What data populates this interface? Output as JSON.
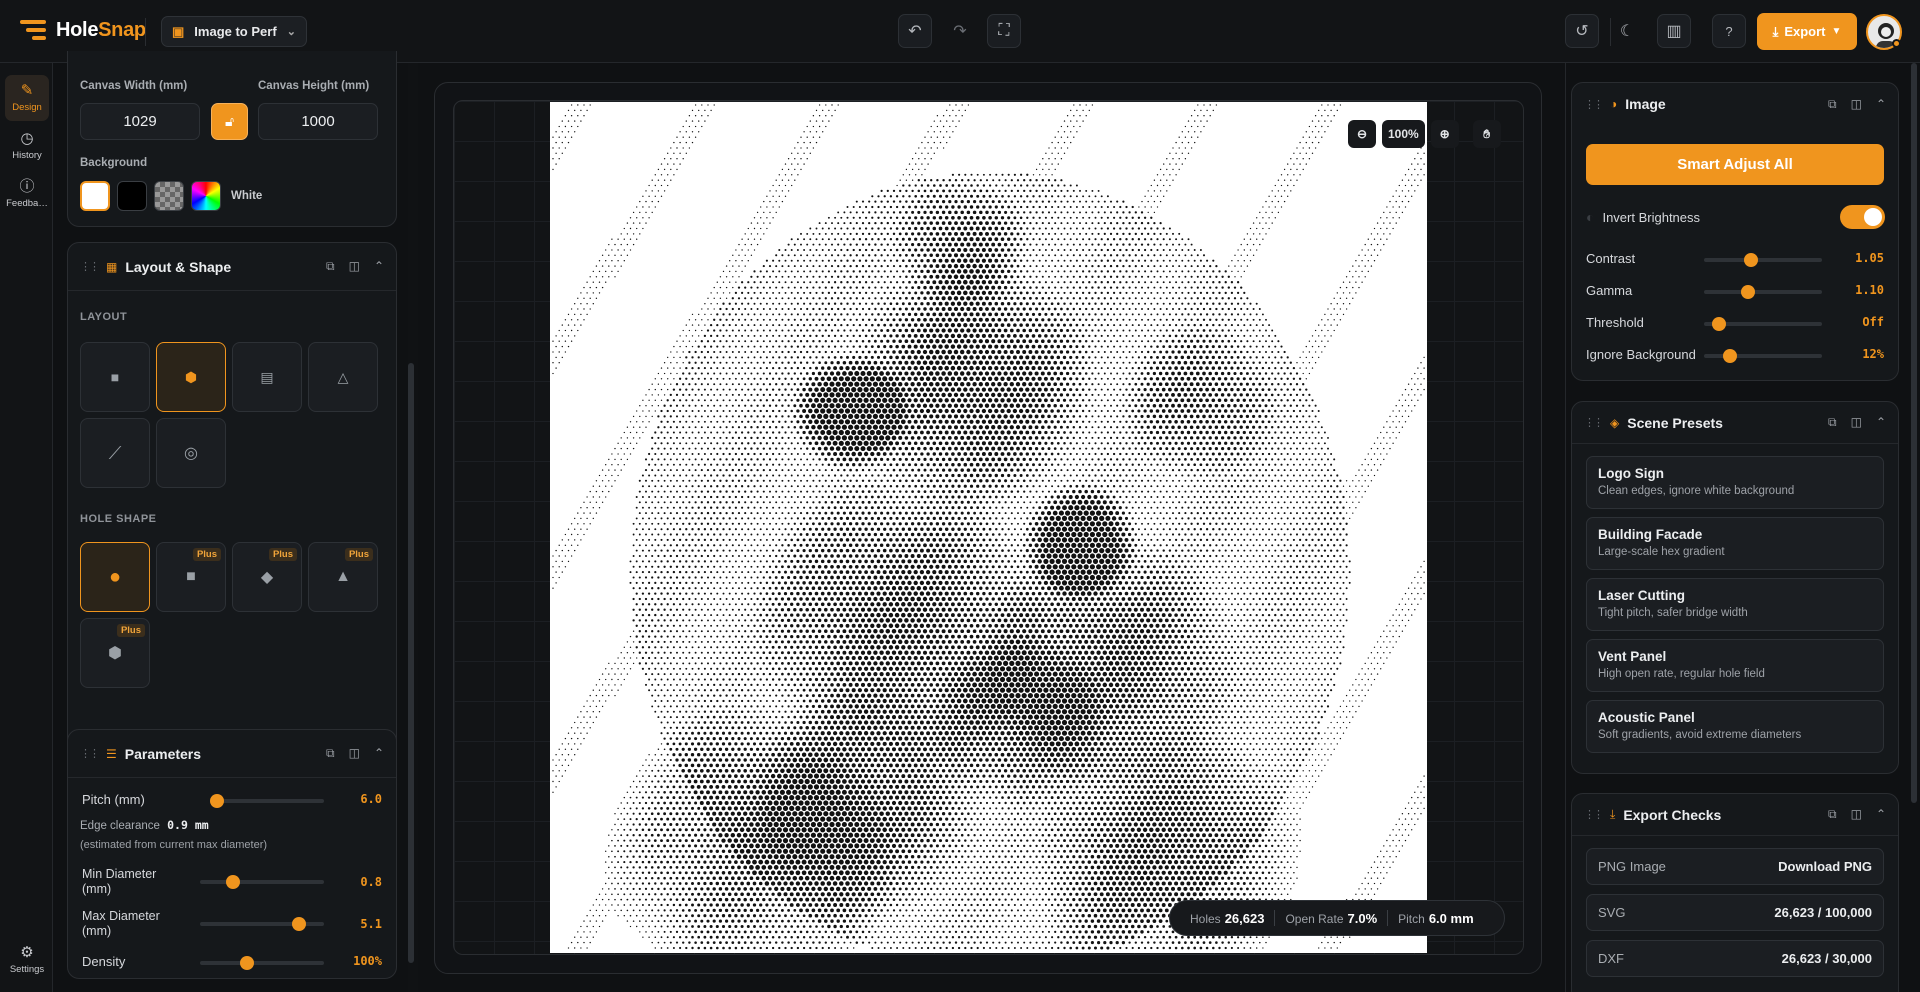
{
  "app": {
    "name_prefix": "Hole",
    "name_suffix": "Snap",
    "mode": "Image to Perf"
  },
  "topbar": {
    "export_label": "Export"
  },
  "rail": {
    "items": [
      {
        "label": "Design",
        "icon": "brush-icon"
      },
      {
        "label": "History",
        "icon": "history-icon"
      },
      {
        "label": "Feedba…",
        "icon": "feedback-icon"
      }
    ],
    "settings_label": "Settings"
  },
  "canvas_settings": {
    "width_label": "Canvas Width (mm)",
    "width_value": "1029",
    "height_label": "Canvas Height (mm)",
    "height_value": "1000",
    "background_label": "Background",
    "background_value": "White",
    "swatches": [
      "#ffffff",
      "#000000",
      "checker",
      "rainbow"
    ]
  },
  "layout_shape": {
    "title": "Layout & Shape",
    "layout_label": "LAYOUT",
    "layouts": [
      "grid-square-icon",
      "hex-icon",
      "staggered-icon",
      "triangle-icon",
      "line-icon",
      "radial-icon"
    ],
    "selected_layout": 1,
    "hole_shape_label": "HOLE SHAPE",
    "shapes": [
      {
        "icon": "circle-icon",
        "badge": ""
      },
      {
        "icon": "square-icon",
        "badge": "Plus"
      },
      {
        "icon": "diamond-icon",
        "badge": "Plus"
      },
      {
        "icon": "triangle-icon",
        "badge": "Plus"
      },
      {
        "icon": "hexagon-icon",
        "badge": "Plus"
      }
    ],
    "selected_shape": 0
  },
  "parameters": {
    "title": "Parameters",
    "pitch": {
      "label": "Pitch (mm)",
      "value": "6.0",
      "level": 0.0
    },
    "edge_clearance_label": "Edge clearance",
    "edge_clearance_value": "0.9 mm",
    "estimate_note": "(estimated from current max diameter)",
    "min_diameter": {
      "label1": "Min Diameter",
      "label2": "(mm)",
      "value": "0.8",
      "level": 0.24
    },
    "max_diameter": {
      "label1": "Max Diameter",
      "label2": "(mm)",
      "value": "5.1",
      "level": 0.84
    },
    "density": {
      "label": "Density",
      "value": "100%",
      "level": 0.36
    }
  },
  "canvas": {
    "zoom": "100%",
    "stats": {
      "holes_label": "Holes",
      "holes": "26,623",
      "open_rate_label": "Open Rate",
      "open_rate": "7.0%",
      "pitch_label": "Pitch",
      "pitch": "6.0 mm"
    }
  },
  "image_panel": {
    "title": "Image",
    "smart_adjust": "Smart Adjust All",
    "invert_label": "Invert Brightness",
    "invert_on": true,
    "adjustments": [
      {
        "label": "Contrast",
        "value": "1.05",
        "level": 0.38
      },
      {
        "label": "Gamma",
        "value": "1.10",
        "level": 0.36
      },
      {
        "label": "Threshold",
        "value": "Off",
        "level": 0.08
      },
      {
        "label": "Ignore Background",
        "value": "12%",
        "level": 0.18
      }
    ]
  },
  "scene_presets": {
    "title": "Scene Presets",
    "items": [
      {
        "name": "Logo Sign",
        "desc": "Clean edges, ignore white background"
      },
      {
        "name": "Building Facade",
        "desc": "Large-scale hex gradient"
      },
      {
        "name": "Laser Cutting",
        "desc": "Tight pitch, safer bridge width"
      },
      {
        "name": "Vent Panel",
        "desc": "High open rate, regular hole field"
      },
      {
        "name": "Acoustic Panel",
        "desc": "Soft gradients, avoid extreme diameters"
      }
    ]
  },
  "export_checks": {
    "title": "Export Checks",
    "rows": [
      {
        "label": "PNG Image",
        "value": "Download PNG"
      },
      {
        "label": "SVG",
        "value": "26,623 / 100,000"
      },
      {
        "label": "DXF",
        "value": "26,623 / 30,000"
      }
    ]
  },
  "colors": {
    "accent": "#f0951e",
    "bg": "#101214",
    "card": "#15181b"
  }
}
